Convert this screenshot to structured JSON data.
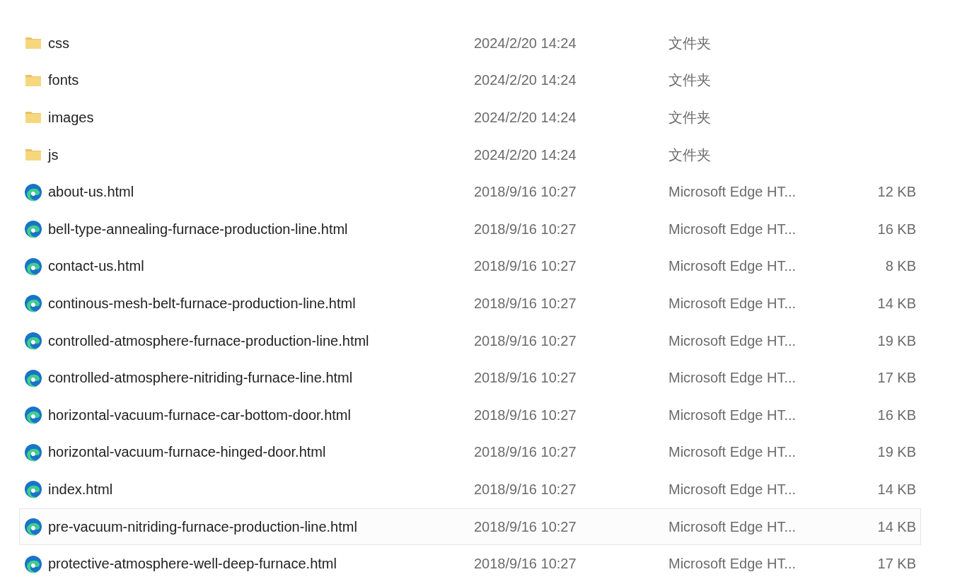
{
  "files": [
    {
      "kind": "folder",
      "name": "css",
      "modified": "2024/2/20 14:24",
      "type": "文件夹",
      "hovered": false
    },
    {
      "kind": "folder",
      "name": "fonts",
      "modified": "2024/2/20 14:24",
      "type": "文件夹",
      "hovered": false
    },
    {
      "kind": "folder",
      "name": "images",
      "modified": "2024/2/20 14:24",
      "type": "文件夹",
      "hovered": false
    },
    {
      "kind": "folder",
      "name": "js",
      "modified": "2024/2/20 14:24",
      "type": "文件夹",
      "hovered": false
    },
    {
      "kind": "html",
      "name": "about-us.html",
      "modified": "2018/9/16 10:27",
      "type": "Microsoft Edge HT...",
      "size": "12 KB",
      "hovered": false
    },
    {
      "kind": "html",
      "name": "bell-type-annealing-furnace-production-line.html",
      "modified": "2018/9/16 10:27",
      "type": "Microsoft Edge HT...",
      "size": "16 KB",
      "hovered": false
    },
    {
      "kind": "html",
      "name": "contact-us.html",
      "modified": "2018/9/16 10:27",
      "type": "Microsoft Edge HT...",
      "size": "8 KB",
      "hovered": false
    },
    {
      "kind": "html",
      "name": "continous-mesh-belt-furnace-production-line.html",
      "modified": "2018/9/16 10:27",
      "type": "Microsoft Edge HT...",
      "size": "14 KB",
      "hovered": false
    },
    {
      "kind": "html",
      "name": "controlled-atmosphere-furnace-production-line.html",
      "modified": "2018/9/16 10:27",
      "type": "Microsoft Edge HT...",
      "size": "19 KB",
      "hovered": false
    },
    {
      "kind": "html",
      "name": "controlled-atmosphere-nitriding-furnace-line.html",
      "modified": "2018/9/16 10:27",
      "type": "Microsoft Edge HT...",
      "size": "17 KB",
      "hovered": false
    },
    {
      "kind": "html",
      "name": "horizontal-vacuum-furnace-car-bottom-door.html",
      "modified": "2018/9/16 10:27",
      "type": "Microsoft Edge HT...",
      "size": "16 KB",
      "hovered": false
    },
    {
      "kind": "html",
      "name": "horizontal-vacuum-furnace-hinged-door.html",
      "modified": "2018/9/16 10:27",
      "type": "Microsoft Edge HT...",
      "size": "19 KB",
      "hovered": false
    },
    {
      "kind": "html",
      "name": "index.html",
      "modified": "2018/9/16 10:27",
      "type": "Microsoft Edge HT...",
      "size": "14 KB",
      "hovered": false
    },
    {
      "kind": "html",
      "name": "pre-vacuum-nitriding-furnace-production-line.html",
      "modified": "2018/9/16 10:27",
      "type": "Microsoft Edge HT...",
      "size": "14 KB",
      "hovered": true
    },
    {
      "kind": "html",
      "name": "protective-atmosphere-well-deep-furnace.html",
      "modified": "2018/9/16 10:27",
      "type": "Microsoft Edge HT...",
      "size": "17 KB",
      "hovered": false
    }
  ]
}
